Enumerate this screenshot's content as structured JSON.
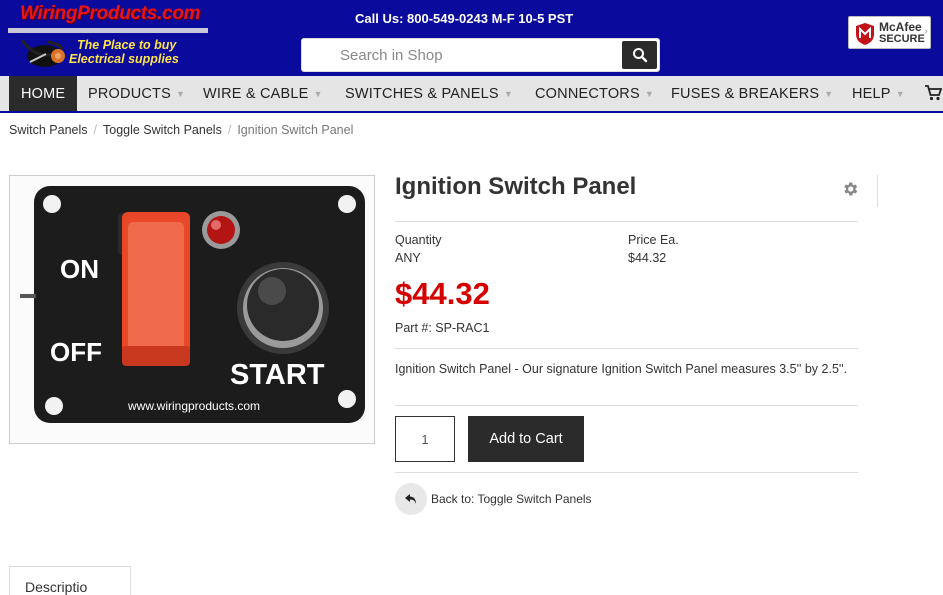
{
  "header": {
    "brand": "WiringProducts.com",
    "tagline_line1": "The Place to buy",
    "tagline_line2": "Electrical supplies",
    "call_text": "Call Us: 800-549-0243 M-F 10-5 PST",
    "search_placeholder": "Search in Shop",
    "badge_line1": "McAfee",
    "badge_line2": "SECURE",
    "badge_color": "#c4121a"
  },
  "nav": {
    "items": [
      {
        "label": "HOME"
      },
      {
        "label": "PRODUCTS"
      },
      {
        "label": "WIRE & CABLE"
      },
      {
        "label": "SWITCHES & PANELS"
      },
      {
        "label": "CONNECTORS"
      },
      {
        "label": "FUSES & BREAKERS"
      },
      {
        "label": "HELP"
      }
    ]
  },
  "breadcrumb": {
    "items": [
      "Switch Panels",
      "Toggle Switch Panels",
      "Ignition Switch Panel"
    ]
  },
  "product": {
    "title": "Ignition Switch Panel",
    "quantity_label": "Quantity",
    "quantity_value": "ANY",
    "price_label": "Price Ea.",
    "price_value": "$44.32",
    "price_big": "$44.32",
    "part_number": "Part #: SP-RAC1",
    "description": "Ignition Switch Panel - Our signature Ignition Switch Panel measures 3.5'' by 2.5''.",
    "qty_input_value": "1",
    "add_to_cart_label": "Add to Cart",
    "back_label": "Back to: Toggle Switch Panels",
    "price_color": "#d40000"
  },
  "image": {
    "label_on": "ON",
    "label_off": "OFF",
    "label_start": "START",
    "url_text": "www.wiringproducts.com"
  },
  "tabs": {
    "partial_label": "Descriptio"
  }
}
